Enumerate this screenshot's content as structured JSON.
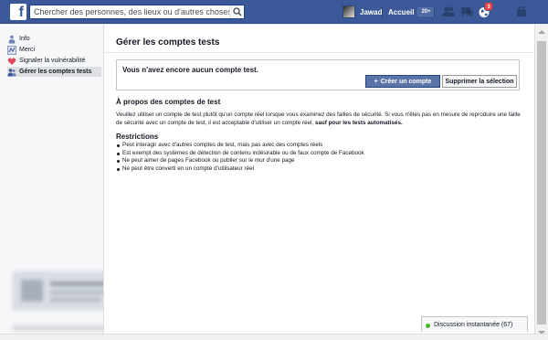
{
  "header": {
    "logo_letter": "f",
    "search_placeholder": "Chercher des personnes, des lieux ou d'autres choses",
    "user_name": "Jawad",
    "home_label": "Accueil",
    "home_count": "20+",
    "notifications_count": "3",
    "brand_color": "#3b5998"
  },
  "sidebar": {
    "items": [
      {
        "label": "Info",
        "icon": "info-icon"
      },
      {
        "label": "Merci",
        "icon": "thanks-icon"
      },
      {
        "label": "Signaler la vulnérabilité",
        "icon": "report-vulnerability-icon"
      },
      {
        "label": "Gérer les comptes tests",
        "icon": "test-accounts-icon",
        "active": true
      }
    ]
  },
  "main": {
    "title": "Gérer les comptes tests",
    "empty_message": "Vous n'avez encore aucun compte test.",
    "create_button": "Créer un compte",
    "delete_button": "Supprimer la sélection",
    "about_heading": "À propos des comptes de test",
    "about_text": "Veuillez utiliser un compte de test plutôt qu'un compte réel lorsque vous examinez des failles de sécurité. Si vous n'êtes pas en mesure de reproduire une faille de sécurité avec un compte de test, il est acceptable d'utiliser un compte réel,",
    "about_text_bold": "sauf pour les tests automatisés.",
    "restrictions_heading": "Restrictions",
    "restrictions": [
      "Peut interagir avec d'autres comptes de test, mais pas avec des comptes réels",
      "Est exempt des systèmes de détection de contenu indésirable ou de faux compte de Facebook",
      "Ne peut aimer de pages Facebook ou publier sur le mur d'une page",
      "Ne peut être converti en un compte d'utilisateur réel"
    ]
  },
  "chat": {
    "label": "Discussion instantanée (67)"
  }
}
